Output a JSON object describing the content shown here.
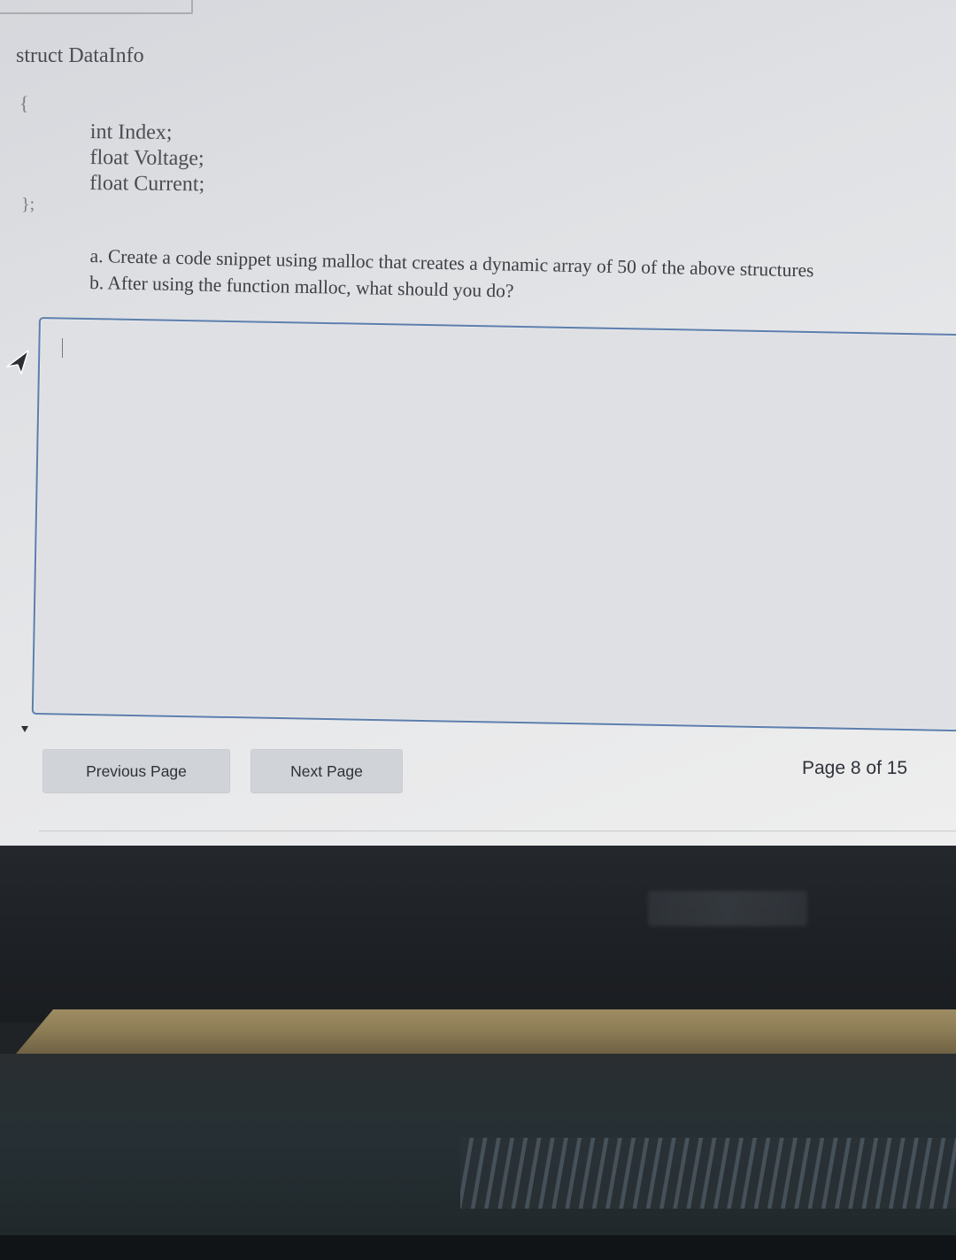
{
  "code": {
    "title": "struct DataInfo",
    "brace_open": "{",
    "brace_close": "};",
    "lines": [
      "int Index;",
      "float Voltage;",
      "float Current;"
    ]
  },
  "question": {
    "line_a": "a. Create a code snippet using malloc that creates a dynamic array of 50 of the above structures",
    "line_b": "b. After using the function malloc, what should you do?"
  },
  "answer": {
    "value": ""
  },
  "navigation": {
    "previous_label": "Previous Page",
    "next_label": "Next Page",
    "page_indicator": "Page 8 of 15"
  },
  "icons": {
    "cursor": "mouse-pointer-icon",
    "scroll": "scroll-down-arrow-icon"
  },
  "colors": {
    "box_border": "#5d7fae",
    "button_bg": "#d0d3d7",
    "text": "#4a4d52"
  }
}
